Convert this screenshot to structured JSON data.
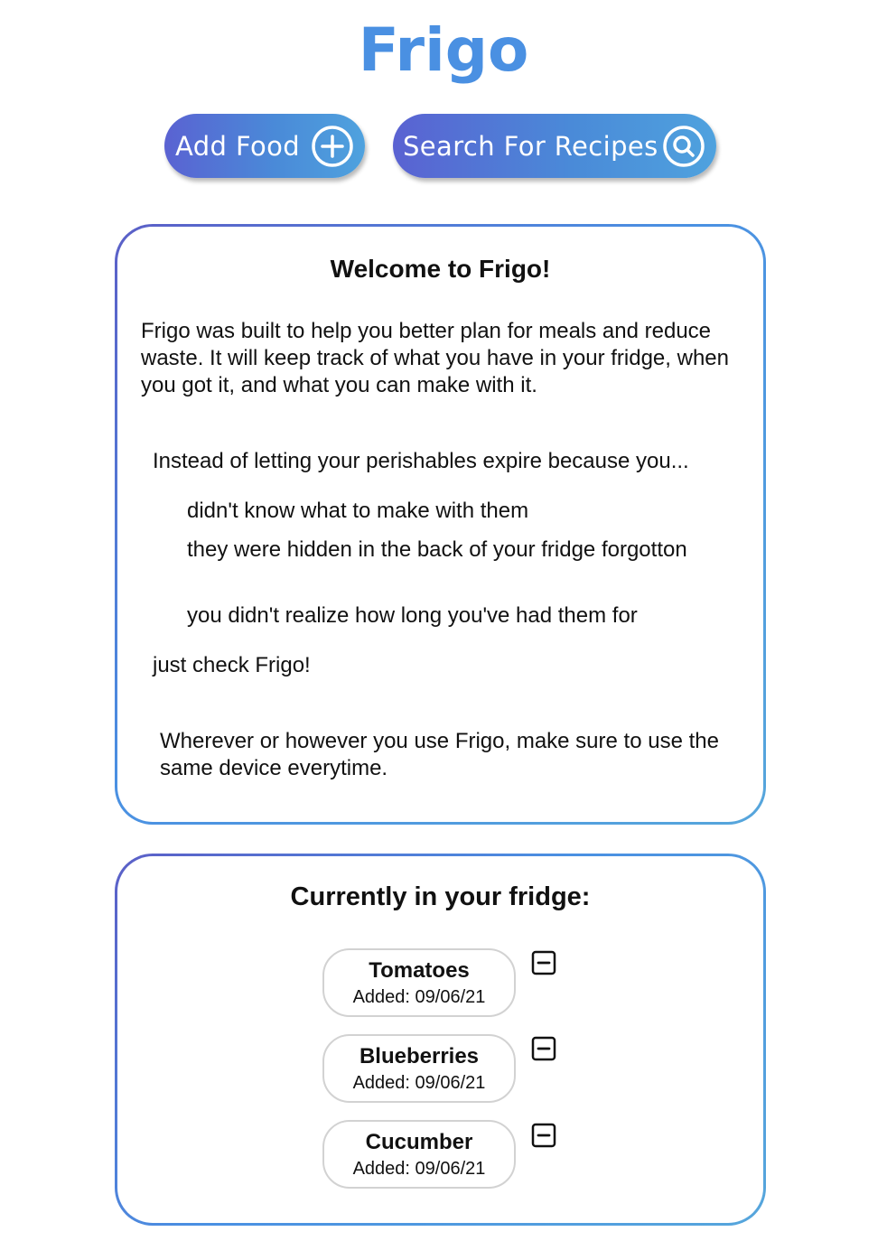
{
  "app": {
    "title": "Frigo",
    "accent_color": "#4a90e2",
    "gradient": [
      "#5a62d2",
      "#4fa2de"
    ]
  },
  "actions": {
    "add_food": {
      "label": "Add Food",
      "icon": "plus-circle-icon"
    },
    "search_recipes": {
      "label": "Search For Recipes",
      "icon": "search-icon"
    }
  },
  "welcome": {
    "title": "Welcome to Frigo!",
    "intro": "Frigo was built to help you better plan for meals and reduce waste. It will keep track of what you have in your fridge, when you got it, and what you can make with it.",
    "instead": "Instead of letting your perishables expire because you...",
    "reasons": [
      "didn't know what to make with them",
      "they were hidden in the back of your fridge forgotton",
      "you didn't realize how long you've had them for"
    ],
    "check": "just check Frigo!",
    "note": "Wherever or however you use Frigo, make sure to use the same device everytime."
  },
  "fridge": {
    "title": "Currently in your fridge:",
    "remove_icon": "minus-square-icon",
    "items": [
      {
        "name": "Tomatoes",
        "added": "Added: 09/06/21"
      },
      {
        "name": "Blueberries",
        "added": "Added: 09/06/21"
      },
      {
        "name": "Cucumber",
        "added": "Added: 09/06/21"
      }
    ]
  }
}
